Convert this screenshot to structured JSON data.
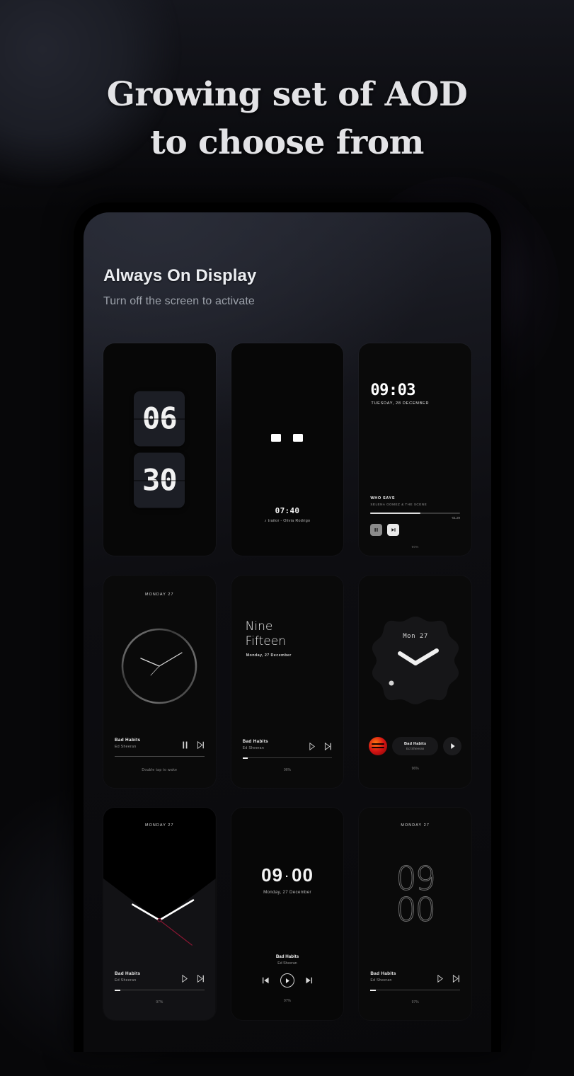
{
  "headline": {
    "line1": "Growing set of AOD",
    "line2": "to choose from"
  },
  "app": {
    "title": "Always On Display",
    "subtitle": "Turn off the screen to activate"
  },
  "cards": [
    {
      "name": "flip-clock",
      "hours": "06",
      "minutes": "30"
    },
    {
      "name": "minimal-squares",
      "time": "07:40",
      "note_icon": "♪",
      "track": "traitor - Olivia Rodrigo"
    },
    {
      "name": "digital-player",
      "time": "09:03",
      "date": "TUESDAY, 28 DECEMBER",
      "track_title": "WHO SAYS",
      "track_artist": "SELENA GOMEZ & THE SCENE",
      "remaining": "-01:29",
      "battery": "90%",
      "pause_icon": "❙❙",
      "next_icon": "▶|"
    },
    {
      "name": "ring-analog",
      "date": "MONDAY 27",
      "track_title": "Bad Habits",
      "track_artist": "Ed Sheeran",
      "hint": "Double tap to wake"
    },
    {
      "name": "word-clock",
      "word_line1": "Nine",
      "word_line2": "Fifteen",
      "date": "Monday, 27 December",
      "track_title": "Bad Habits",
      "track_artist": "Ed Sheeran",
      "battery": "96%"
    },
    {
      "name": "blob-watchface",
      "date": "Mon 27",
      "track_title": "Bad Habits",
      "track_artist": "Ed Sheeran",
      "battery": "96%"
    },
    {
      "name": "wedge-analog",
      "date": "MONDAY 27",
      "track_title": "Bad Habits",
      "track_artist": "Ed Sheeran",
      "battery": "97%"
    },
    {
      "name": "centered-digital",
      "time_hours": "09",
      "time_separator": "·",
      "time_minutes": "00",
      "date": "Monday, 27 December",
      "track_title": "Bad Habits",
      "track_artist": "Ed Sheeran",
      "battery": "97%"
    },
    {
      "name": "outline-digits",
      "date": "MONDAY 27",
      "digits_line1": "09",
      "digits_line2": "00",
      "track_title": "Bad Habits",
      "track_artist": "Ed Sheeran",
      "battery": "97%"
    }
  ],
  "colors": {
    "page_background": "#070709",
    "headline_text": "#e3e3e6",
    "app_title": "#eceef2",
    "app_subtitle": "#9ba0a9",
    "card_background": "#070707",
    "flip_cell": "#1c1e25",
    "accent_red": "#d61414",
    "second_hand_red": "#8c1733"
  }
}
